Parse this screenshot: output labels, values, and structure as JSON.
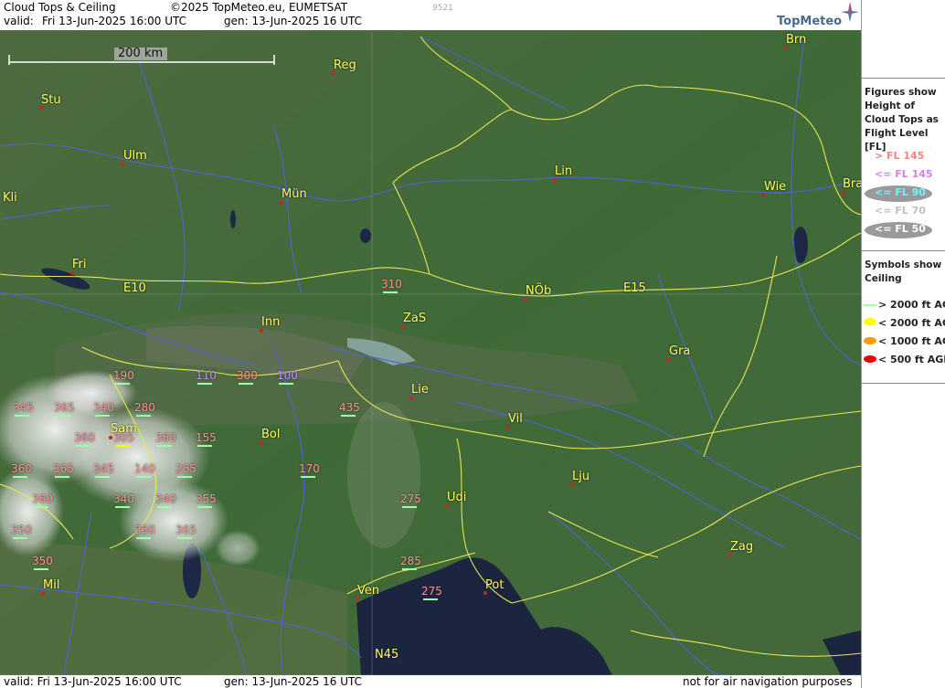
{
  "header": {
    "product": "Cloud Tops & Ceiling",
    "copyright": "©2025 TopMeteo.eu, EUMETSAT",
    "valid_label": "valid:",
    "valid_time": "Fri  13-Jun-2025  16:00 UTC",
    "gen": "gen: 13-Jun-2025 16 UTC",
    "code": "9521",
    "logo": "TopMeteo"
  },
  "footer": {
    "valid": "valid:  Fri  13-Jun-2025  16:00 UTC",
    "gen": "gen: 13-Jun-2025 16 UTC",
    "disclaimer": "not for air navigation purposes"
  },
  "scale_bar": {
    "label": "200 km"
  },
  "legend": {
    "tops_title": "Figures show Height of Cloud Tops as Flight Level  [FL]",
    "tops": [
      {
        "label": "> FL 145",
        "color": "#ff8080"
      },
      {
        "label": "<= FL 145",
        "color": "#d080ff"
      },
      {
        "label": "<= FL 90",
        "color": "#60ffff"
      },
      {
        "label": "<= FL 70",
        "color": "#c0c0c0"
      },
      {
        "label": "<= FL 50",
        "color": "#ffffff"
      }
    ],
    "ceiling_title": "Symbols show Ceiling",
    "ceiling": [
      {
        "label": "> 2000 ft AGL",
        "color": "#a0ffa0"
      },
      {
        "label": "< 2000 ft AGL",
        "color": "#ffff00"
      },
      {
        "label": "< 1000 ft AGL",
        "color": "#ff9900"
      },
      {
        "label": "< 500 ft AGL",
        "color": "#ee0000"
      }
    ]
  },
  "cities": [
    {
      "name": "Brn"
    },
    {
      "name": "Reg"
    },
    {
      "name": "Stu"
    },
    {
      "name": "Ulm"
    },
    {
      "name": "Kli"
    },
    {
      "name": "Mün"
    },
    {
      "name": "Lin"
    },
    {
      "name": "Wie"
    },
    {
      "name": "Bra"
    },
    {
      "name": "Fri"
    },
    {
      "name": "E10"
    },
    {
      "name": "E15"
    },
    {
      "name": "NÖb"
    },
    {
      "name": "ZaS"
    },
    {
      "name": "Inn"
    },
    {
      "name": "Gra"
    },
    {
      "name": "Lie"
    },
    {
      "name": "Vil"
    },
    {
      "name": "Sam"
    },
    {
      "name": "Bol"
    },
    {
      "name": "Lju"
    },
    {
      "name": "Udi"
    },
    {
      "name": "Zag"
    },
    {
      "name": "Mil"
    },
    {
      "name": "Ven"
    },
    {
      "name": "Pot"
    },
    {
      "name": "N45"
    }
  ],
  "flight_levels": [
    {
      "value": "310",
      "cls": "high"
    },
    {
      "value": "190",
      "cls": "high"
    },
    {
      "value": "110",
      "cls": "mid"
    },
    {
      "value": "300",
      "cls": "high"
    },
    {
      "value": "100",
      "cls": "mid"
    },
    {
      "value": "345",
      "cls": "high"
    },
    {
      "value": "365",
      "cls": "high"
    },
    {
      "value": "340",
      "cls": "high"
    },
    {
      "value": "280",
      "cls": "high"
    },
    {
      "value": "435",
      "cls": "high"
    },
    {
      "value": "305",
      "cls": "high"
    },
    {
      "value": "360",
      "cls": "high"
    },
    {
      "value": "155",
      "cls": "high"
    },
    {
      "value": "360",
      "cls": "high"
    },
    {
      "value": "365",
      "cls": "high"
    },
    {
      "value": "345",
      "cls": "high"
    },
    {
      "value": "140",
      "cls": "high"
    },
    {
      "value": "265",
      "cls": "high"
    },
    {
      "value": "170",
      "cls": "high"
    },
    {
      "value": "360",
      "cls": "high"
    },
    {
      "value": "340",
      "cls": "high"
    },
    {
      "value": "340",
      "cls": "high"
    },
    {
      "value": "355",
      "cls": "high"
    },
    {
      "value": "275",
      "cls": "high"
    },
    {
      "value": "350",
      "cls": "high"
    },
    {
      "value": "350",
      "cls": "high"
    },
    {
      "value": "365",
      "cls": "high"
    },
    {
      "value": "350",
      "cls": "high"
    },
    {
      "value": "285",
      "cls": "high"
    },
    {
      "value": "275",
      "cls": "high"
    },
    {
      "value": "360",
      "cls": "high"
    }
  ]
}
